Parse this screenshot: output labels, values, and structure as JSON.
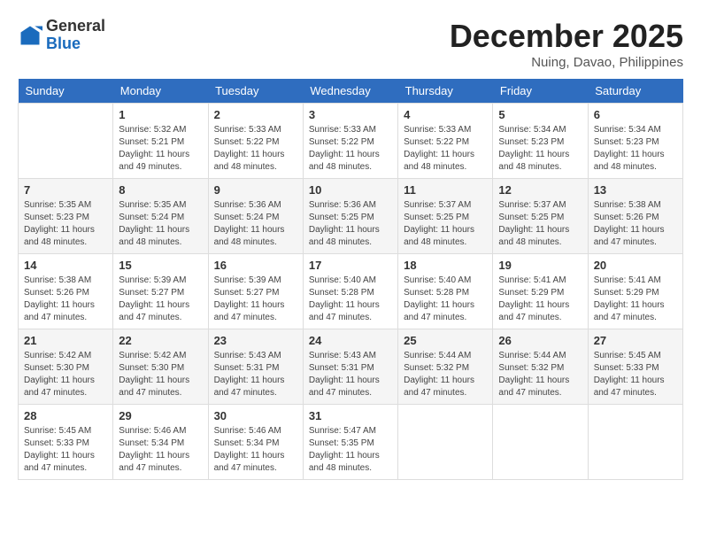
{
  "header": {
    "logo": {
      "general": "General",
      "blue": "Blue"
    },
    "title": "December 2025",
    "location": "Nuing, Davao, Philippines"
  },
  "calendar": {
    "days_of_week": [
      "Sunday",
      "Monday",
      "Tuesday",
      "Wednesday",
      "Thursday",
      "Friday",
      "Saturday"
    ],
    "weeks": [
      [
        {
          "day": "",
          "info": ""
        },
        {
          "day": "1",
          "info": "Sunrise: 5:32 AM\nSunset: 5:21 PM\nDaylight: 11 hours\nand 49 minutes."
        },
        {
          "day": "2",
          "info": "Sunrise: 5:33 AM\nSunset: 5:22 PM\nDaylight: 11 hours\nand 48 minutes."
        },
        {
          "day": "3",
          "info": "Sunrise: 5:33 AM\nSunset: 5:22 PM\nDaylight: 11 hours\nand 48 minutes."
        },
        {
          "day": "4",
          "info": "Sunrise: 5:33 AM\nSunset: 5:22 PM\nDaylight: 11 hours\nand 48 minutes."
        },
        {
          "day": "5",
          "info": "Sunrise: 5:34 AM\nSunset: 5:23 PM\nDaylight: 11 hours\nand 48 minutes."
        },
        {
          "day": "6",
          "info": "Sunrise: 5:34 AM\nSunset: 5:23 PM\nDaylight: 11 hours\nand 48 minutes."
        }
      ],
      [
        {
          "day": "7",
          "info": "Sunrise: 5:35 AM\nSunset: 5:23 PM\nDaylight: 11 hours\nand 48 minutes."
        },
        {
          "day": "8",
          "info": "Sunrise: 5:35 AM\nSunset: 5:24 PM\nDaylight: 11 hours\nand 48 minutes."
        },
        {
          "day": "9",
          "info": "Sunrise: 5:36 AM\nSunset: 5:24 PM\nDaylight: 11 hours\nand 48 minutes."
        },
        {
          "day": "10",
          "info": "Sunrise: 5:36 AM\nSunset: 5:25 PM\nDaylight: 11 hours\nand 48 minutes."
        },
        {
          "day": "11",
          "info": "Sunrise: 5:37 AM\nSunset: 5:25 PM\nDaylight: 11 hours\nand 48 minutes."
        },
        {
          "day": "12",
          "info": "Sunrise: 5:37 AM\nSunset: 5:25 PM\nDaylight: 11 hours\nand 48 minutes."
        },
        {
          "day": "13",
          "info": "Sunrise: 5:38 AM\nSunset: 5:26 PM\nDaylight: 11 hours\nand 47 minutes."
        }
      ],
      [
        {
          "day": "14",
          "info": "Sunrise: 5:38 AM\nSunset: 5:26 PM\nDaylight: 11 hours\nand 47 minutes."
        },
        {
          "day": "15",
          "info": "Sunrise: 5:39 AM\nSunset: 5:27 PM\nDaylight: 11 hours\nand 47 minutes."
        },
        {
          "day": "16",
          "info": "Sunrise: 5:39 AM\nSunset: 5:27 PM\nDaylight: 11 hours\nand 47 minutes."
        },
        {
          "day": "17",
          "info": "Sunrise: 5:40 AM\nSunset: 5:28 PM\nDaylight: 11 hours\nand 47 minutes."
        },
        {
          "day": "18",
          "info": "Sunrise: 5:40 AM\nSunset: 5:28 PM\nDaylight: 11 hours\nand 47 minutes."
        },
        {
          "day": "19",
          "info": "Sunrise: 5:41 AM\nSunset: 5:29 PM\nDaylight: 11 hours\nand 47 minutes."
        },
        {
          "day": "20",
          "info": "Sunrise: 5:41 AM\nSunset: 5:29 PM\nDaylight: 11 hours\nand 47 minutes."
        }
      ],
      [
        {
          "day": "21",
          "info": "Sunrise: 5:42 AM\nSunset: 5:30 PM\nDaylight: 11 hours\nand 47 minutes."
        },
        {
          "day": "22",
          "info": "Sunrise: 5:42 AM\nSunset: 5:30 PM\nDaylight: 11 hours\nand 47 minutes."
        },
        {
          "day": "23",
          "info": "Sunrise: 5:43 AM\nSunset: 5:31 PM\nDaylight: 11 hours\nand 47 minutes."
        },
        {
          "day": "24",
          "info": "Sunrise: 5:43 AM\nSunset: 5:31 PM\nDaylight: 11 hours\nand 47 minutes."
        },
        {
          "day": "25",
          "info": "Sunrise: 5:44 AM\nSunset: 5:32 PM\nDaylight: 11 hours\nand 47 minutes."
        },
        {
          "day": "26",
          "info": "Sunrise: 5:44 AM\nSunset: 5:32 PM\nDaylight: 11 hours\nand 47 minutes."
        },
        {
          "day": "27",
          "info": "Sunrise: 5:45 AM\nSunset: 5:33 PM\nDaylight: 11 hours\nand 47 minutes."
        }
      ],
      [
        {
          "day": "28",
          "info": "Sunrise: 5:45 AM\nSunset: 5:33 PM\nDaylight: 11 hours\nand 47 minutes."
        },
        {
          "day": "29",
          "info": "Sunrise: 5:46 AM\nSunset: 5:34 PM\nDaylight: 11 hours\nand 47 minutes."
        },
        {
          "day": "30",
          "info": "Sunrise: 5:46 AM\nSunset: 5:34 PM\nDaylight: 11 hours\nand 47 minutes."
        },
        {
          "day": "31",
          "info": "Sunrise: 5:47 AM\nSunset: 5:35 PM\nDaylight: 11 hours\nand 48 minutes."
        },
        {
          "day": "",
          "info": ""
        },
        {
          "day": "",
          "info": ""
        },
        {
          "day": "",
          "info": ""
        }
      ]
    ]
  }
}
